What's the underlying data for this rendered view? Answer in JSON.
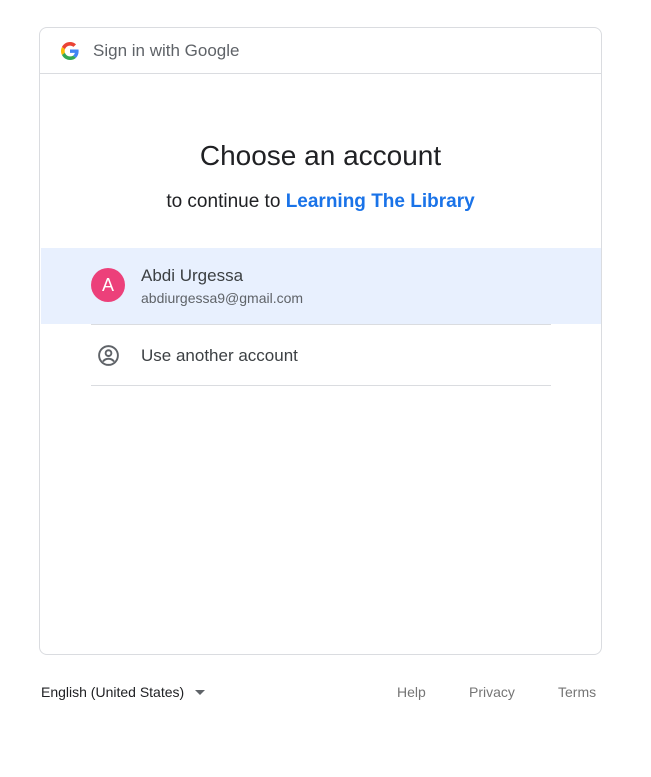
{
  "header": {
    "title": "Sign in with Google",
    "logo_icon": "google-g-icon"
  },
  "main": {
    "heading": "Choose an account",
    "subheading_prefix": "to continue to ",
    "app_name": "Learning The Library"
  },
  "accounts": [
    {
      "initial": "A",
      "name": "Abdi Urgessa",
      "email": "abdiurgessa9@gmail.com",
      "avatar_color": "#ec407a"
    }
  ],
  "use_another": {
    "label": "Use another account",
    "icon": "account-circle-icon"
  },
  "footer": {
    "language": "English (United States)",
    "links": [
      "Help",
      "Privacy",
      "Terms"
    ]
  },
  "colors": {
    "accent": "#1a73e8",
    "selected_row": "#e8f0fe",
    "border": "#dadce0"
  }
}
